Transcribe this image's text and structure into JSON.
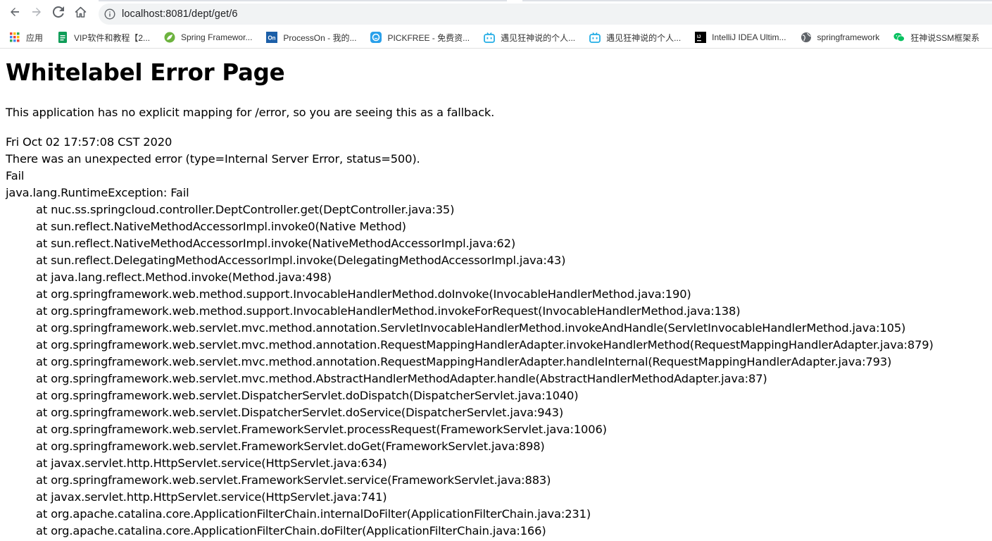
{
  "browser": {
    "url": "localhost:8081/dept/get/6",
    "bookmarks": [
      {
        "icon": "apps-grid-icon",
        "label": "应用",
        "color": "#4285f4"
      },
      {
        "icon": "green-doc-icon",
        "label": "VIP软件和教程【2...",
        "color": "#0f9d58"
      },
      {
        "icon": "spring-leaf-icon",
        "label": "Spring Framewor...",
        "color": "#6db33f"
      },
      {
        "icon": "processon-icon",
        "label": "ProcessOn - 我的...",
        "color": "#1c5fa8"
      },
      {
        "icon": "pickfree-icon",
        "label": "PICKFREE - 免费资...",
        "color": "#2aa0ea"
      },
      {
        "icon": "bilibili-icon",
        "label": "遇见狂神说的个人...",
        "color": "#23ade5"
      },
      {
        "icon": "bilibili-icon",
        "label": "遇见狂神说的个人...",
        "color": "#23ade5"
      },
      {
        "icon": "jetbrains-icon",
        "label": "IntelliJ IDEA Ultim...",
        "color": "#000000"
      },
      {
        "icon": "globe-icon",
        "label": "springframework",
        "color": "#5f6368"
      },
      {
        "icon": "wechat-icon",
        "label": "狂神说SSM框架系",
        "color": "#07c160"
      }
    ]
  },
  "page": {
    "title": "Whitelabel Error Page",
    "fallback_message": "This application has no explicit mapping for /error, so you are seeing this as a fallback.",
    "timestamp": "Fri Oct 02 17:57:08 CST 2020",
    "error_summary": "There was an unexpected error (type=Internal Server Error, status=500).",
    "message": "Fail",
    "exception": "java.lang.RuntimeException: Fail",
    "stack_trace": [
      "at nuc.ss.springcloud.controller.DeptController.get(DeptController.java:35)",
      "at sun.reflect.NativeMethodAccessorImpl.invoke0(Native Method)",
      "at sun.reflect.NativeMethodAccessorImpl.invoke(NativeMethodAccessorImpl.java:62)",
      "at sun.reflect.DelegatingMethodAccessorImpl.invoke(DelegatingMethodAccessorImpl.java:43)",
      "at java.lang.reflect.Method.invoke(Method.java:498)",
      "at org.springframework.web.method.support.InvocableHandlerMethod.doInvoke(InvocableHandlerMethod.java:190)",
      "at org.springframework.web.method.support.InvocableHandlerMethod.invokeForRequest(InvocableHandlerMethod.java:138)",
      "at org.springframework.web.servlet.mvc.method.annotation.ServletInvocableHandlerMethod.invokeAndHandle(ServletInvocableHandlerMethod.java:105)",
      "at org.springframework.web.servlet.mvc.method.annotation.RequestMappingHandlerAdapter.invokeHandlerMethod(RequestMappingHandlerAdapter.java:879)",
      "at org.springframework.web.servlet.mvc.method.annotation.RequestMappingHandlerAdapter.handleInternal(RequestMappingHandlerAdapter.java:793)",
      "at org.springframework.web.servlet.mvc.method.AbstractHandlerMethodAdapter.handle(AbstractHandlerMethodAdapter.java:87)",
      "at org.springframework.web.servlet.DispatcherServlet.doDispatch(DispatcherServlet.java:1040)",
      "at org.springframework.web.servlet.DispatcherServlet.doService(DispatcherServlet.java:943)",
      "at org.springframework.web.servlet.FrameworkServlet.processRequest(FrameworkServlet.java:1006)",
      "at org.springframework.web.servlet.FrameworkServlet.doGet(FrameworkServlet.java:898)",
      "at javax.servlet.http.HttpServlet.service(HttpServlet.java:634)",
      "at org.springframework.web.servlet.FrameworkServlet.service(FrameworkServlet.java:883)",
      "at javax.servlet.http.HttpServlet.service(HttpServlet.java:741)",
      "at org.apache.catalina.core.ApplicationFilterChain.internalDoFilter(ApplicationFilterChain.java:231)",
      "at org.apache.catalina.core.ApplicationFilterChain.doFilter(ApplicationFilterChain.java:166)"
    ]
  }
}
